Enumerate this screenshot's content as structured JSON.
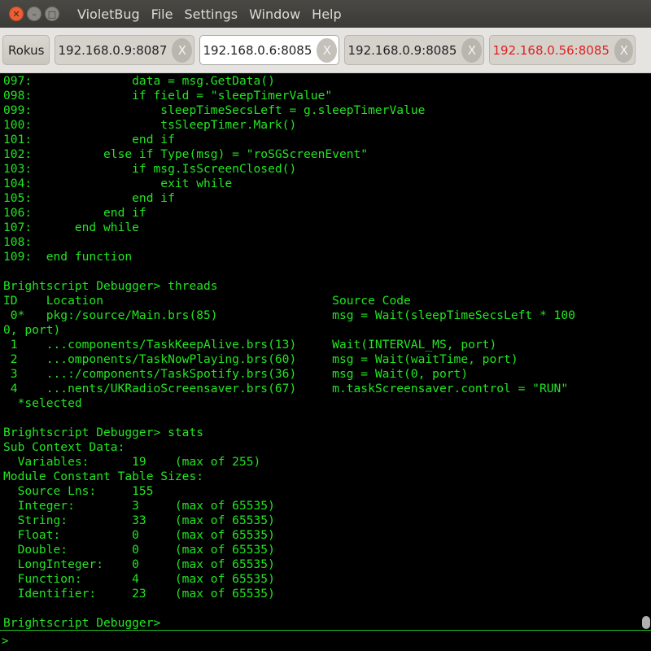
{
  "window": {
    "close_glyph": "✕",
    "min_glyph": "–",
    "max_glyph": "□",
    "app_name": "VioletBug",
    "menu": [
      "File",
      "Settings",
      "Window",
      "Help"
    ]
  },
  "tabs": {
    "rokus_label": "Rokus",
    "close_label": "X",
    "items": [
      {
        "label": "192.168.0.9:8087",
        "active": false,
        "error": false
      },
      {
        "label": "192.168.0.6:8085",
        "active": true,
        "error": false
      },
      {
        "label": "192.168.0.9:8085",
        "active": false,
        "error": false
      },
      {
        "label": "192.168.0.56:8085",
        "active": false,
        "error": true
      }
    ],
    "error_color": "#e02020"
  },
  "console": {
    "text_color": "#22e522",
    "output": "097:              data = msg.GetData()\n098:              if field = \"sleepTimerValue\"\n099:                  sleepTimeSecsLeft = g.sleepTimerValue\n100:                  tsSleepTimer.Mark()\n101:              end if\n102:          else if Type(msg) = \"roSGScreenEvent\"\n103:              if msg.IsScreenClosed()\n104:                  exit while\n105:              end if\n106:          end if\n107:      end while\n108:\n109:  end function\n\nBrightscript Debugger> threads\nID    Location                                Source Code\n 0*   pkg:/source/Main.brs(85)                msg = Wait(sleepTimeSecsLeft * 100\n0, port)\n 1    ...components/TaskKeepAlive.brs(13)     Wait(INTERVAL_MS, port)\n 2    ...omponents/TaskNowPlaying.brs(60)     msg = Wait(waitTime, port)\n 3    ...:/components/TaskSpotify.brs(36)     msg = Wait(0, port)\n 4    ...nents/UKRadioScreensaver.brs(67)     m.taskScreensaver.control = \"RUN\"\n  *selected\n\nBrightscript Debugger> stats\nSub Context Data:\n  Variables:      19    (max of 255)\nModule Constant Table Sizes:\n  Source Lns:     155\n  Integer:        3     (max of 65535)\n  String:         33    (max of 65535)\n  Float:          0     (max of 65535)\n  Double:         0     (max of 65535)\n  LongInteger:    0     (max of 65535)\n  Function:       4     (max of 65535)\n  Identifier:     23    (max of 65535)\n\nBrightscript Debugger>"
  },
  "input": {
    "prompt": ">",
    "value": ""
  }
}
